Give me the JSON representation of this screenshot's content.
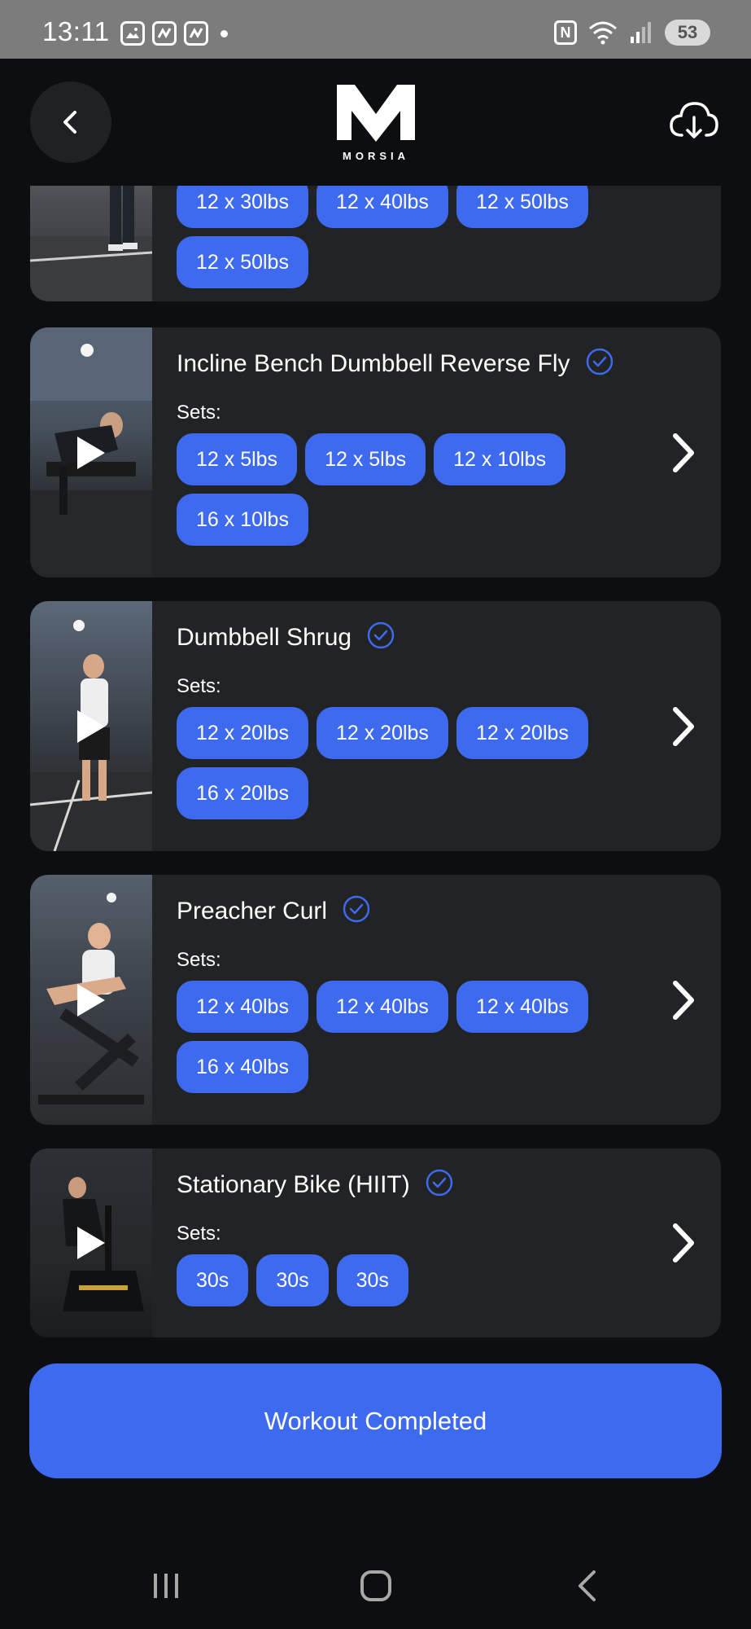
{
  "status_bar": {
    "time": "13:11",
    "battery": "53",
    "nfc": "N"
  },
  "header": {
    "logo_text": "MORSIA",
    "back_icon": "chevron-left-icon",
    "download_icon": "cloud-download-icon"
  },
  "exercises": [
    {
      "title": "",
      "sets_label": "",
      "completed": false,
      "sets": [
        "12 x 30lbs",
        "12 x 40lbs",
        "12 x 50lbs",
        "12 x 50lbs"
      ]
    },
    {
      "title": "Incline Bench Dumbbell Reverse Fly",
      "sets_label": "Sets:",
      "completed": true,
      "sets": [
        "12 x 5lbs",
        "12 x 5lbs",
        "12 x 10lbs",
        "16 x 10lbs"
      ]
    },
    {
      "title": "Dumbbell Shrug",
      "sets_label": "Sets:",
      "completed": true,
      "sets": [
        "12 x 20lbs",
        "12 x 20lbs",
        "12 x 20lbs",
        "16 x 20lbs"
      ]
    },
    {
      "title": "Preacher Curl",
      "sets_label": "Sets:",
      "completed": true,
      "sets": [
        "12 x 40lbs",
        "12 x 40lbs",
        "12 x 40lbs",
        "16 x 40lbs"
      ]
    },
    {
      "title": "Stationary Bike (HIIT)",
      "sets_label": "Sets:",
      "completed": true,
      "sets": [
        "30s",
        "30s",
        "30s"
      ]
    }
  ],
  "complete_button": {
    "label": "Workout Completed"
  },
  "colors": {
    "accent": "#3e6af0",
    "card": "#212325",
    "background": "#0d0e10"
  }
}
